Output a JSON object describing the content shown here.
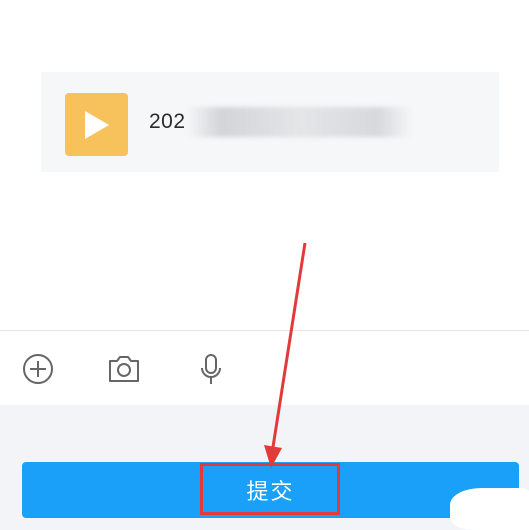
{
  "attachment": {
    "file_name": "202",
    "thumb_icon": "play-icon",
    "thumb_color": "#f7c25b"
  },
  "toolbar": {
    "icons": [
      "add-icon",
      "camera-icon",
      "microphone-icon"
    ]
  },
  "submit": {
    "label": "提交",
    "color": "#1aa0f8"
  },
  "annotation": {
    "color": "#e23a3a"
  }
}
